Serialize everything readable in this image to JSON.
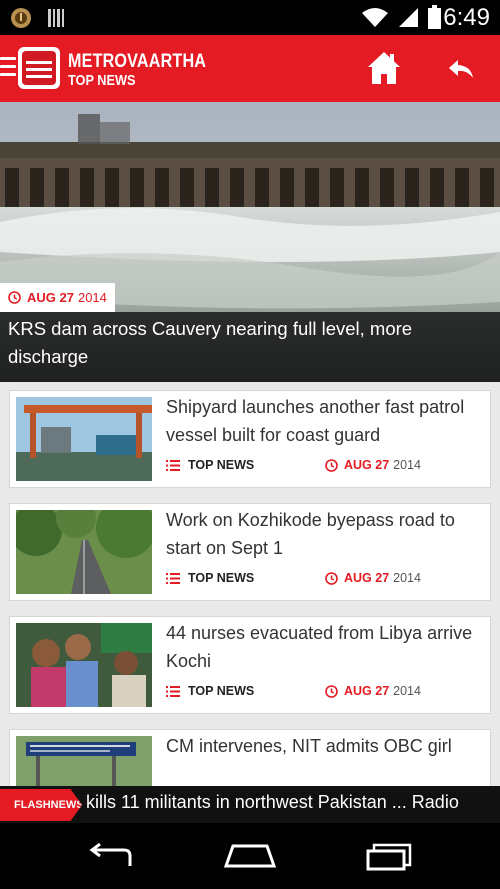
{
  "status_bar": {
    "time": "6:49",
    "icons": [
      "record-icon",
      "barcode-icon",
      "wifi-icon",
      "signal-icon",
      "battery-icon"
    ]
  },
  "app_bar": {
    "brand": "METROVAARTHA",
    "section": "TOP NEWS",
    "color": "#e41b23",
    "icons": [
      "menu-icon",
      "logo",
      "home-icon",
      "back-arrow-icon"
    ]
  },
  "hero": {
    "date_bold": "AUG 27",
    "date_year": "2014",
    "title": "KRS dam across Cauvery nearing full level, more discharge"
  },
  "articles": [
    {
      "title": "Shipyard launches another fast patrol vessel built for coast guard",
      "category": "TOP NEWS",
      "date_bold": "AUG 27",
      "date_year": "2014"
    },
    {
      "title": "Work on Kozhikode byepass road to start on Sept 1",
      "category": "TOP NEWS",
      "date_bold": "AUG 27",
      "date_year": "2014"
    },
    {
      "title": "44 nurses evacuated from Libya arrive Kochi",
      "category": "TOP NEWS",
      "date_bold": "AUG 27",
      "date_year": "2014"
    },
    {
      "title": "CM intervenes, NIT admits OBC girl"
    }
  ],
  "flash": {
    "label": "FLASHNEWS",
    "text": "kills 11 militants in northwest Pakistan ... Radio"
  },
  "nav_bar": {
    "icons": [
      "back-icon",
      "home-icon",
      "recent-apps-icon"
    ]
  }
}
